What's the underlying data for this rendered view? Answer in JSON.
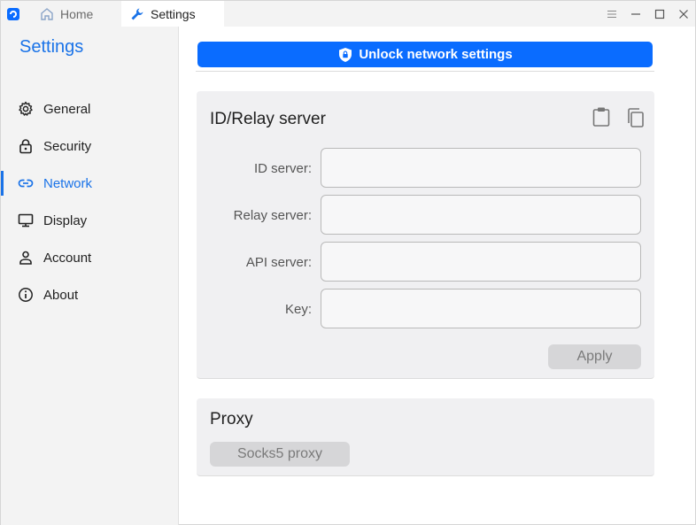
{
  "titlebar": {
    "tabs": [
      {
        "label": "Home",
        "icon": "home-icon"
      },
      {
        "label": "Settings",
        "icon": "wrench-icon"
      }
    ]
  },
  "sidebar": {
    "title": "Settings",
    "items": [
      {
        "label": "General",
        "icon": "gear-icon"
      },
      {
        "label": "Security",
        "icon": "lock-icon"
      },
      {
        "label": "Network",
        "icon": "link-icon",
        "active": true
      },
      {
        "label": "Display",
        "icon": "monitor-icon"
      },
      {
        "label": "Account",
        "icon": "person-icon"
      },
      {
        "label": "About",
        "icon": "info-icon"
      }
    ]
  },
  "main": {
    "unlock_label": "Unlock network settings",
    "relay": {
      "title": "ID/Relay server",
      "fields": [
        {
          "label": "ID server:",
          "value": ""
        },
        {
          "label": "Relay server:",
          "value": ""
        },
        {
          "label": "API server:",
          "value": ""
        },
        {
          "label": "Key:",
          "value": ""
        }
      ],
      "apply_label": "Apply"
    },
    "proxy": {
      "title": "Proxy",
      "socks_label": "Socks5 proxy"
    }
  },
  "colors": {
    "accent": "#1a73e8",
    "unlock_button": "#0a6cff",
    "card_bg": "#f0f0f2",
    "sidebar_bg": "#f3f3f3"
  }
}
